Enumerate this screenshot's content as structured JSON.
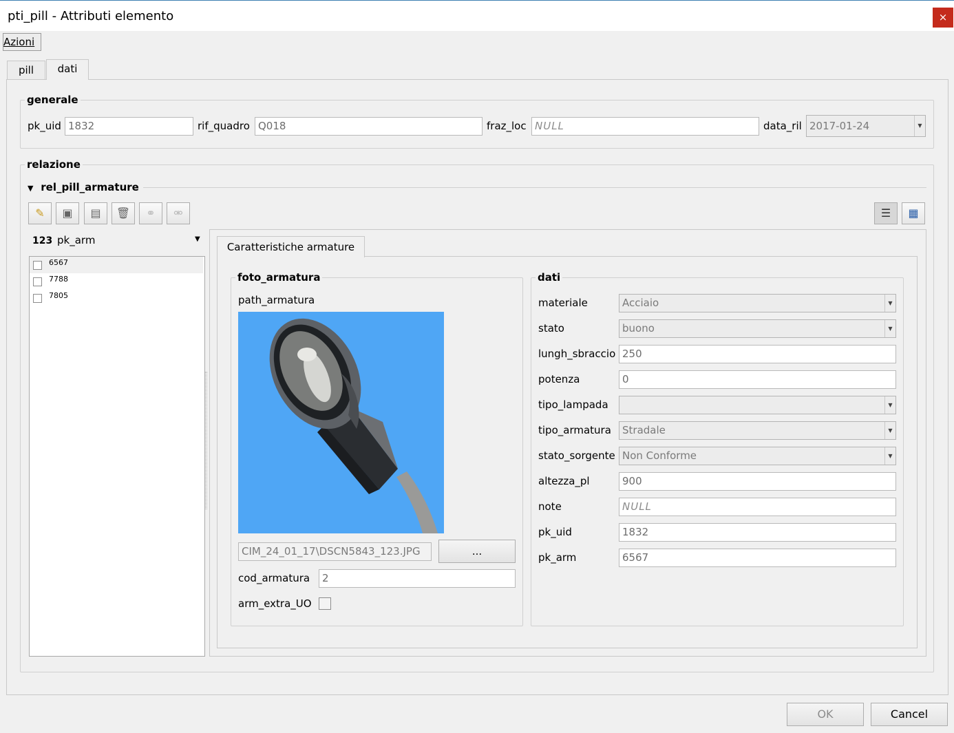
{
  "window": {
    "title": "pti_pill - Attributi elemento",
    "close": "×"
  },
  "menu": {
    "azioni": "Azioni"
  },
  "tabs": [
    {
      "label": "pill"
    },
    {
      "label": "dati"
    }
  ],
  "generale": {
    "title": "generale",
    "pk_uid_label": "pk_uid",
    "pk_uid_value": "1832",
    "rif_quadro_label": "rif_quadro",
    "rif_quadro_value": "Q018",
    "fraz_loc_label": "fraz_loc",
    "fraz_loc_value": "NULL",
    "data_ril_label": "data_ril",
    "data_ril_value": "2017-01-24"
  },
  "relazione": {
    "title": "relazione",
    "rel_title": "rel_pill_armature",
    "list_header_prefix": "123",
    "list_header": "pk_arm",
    "items": [
      "6567",
      "7788",
      "7805"
    ]
  },
  "subtab": {
    "label": "Caratteristiche armature"
  },
  "foto": {
    "title": "foto_armatura",
    "path_label": "path_armatura",
    "file_path": "CIM_24_01_17\\DSCN5843_123.JPG",
    "browse": "...",
    "cod_label": "cod_armatura",
    "cod_value": "2",
    "extra_label": "arm_extra_UO"
  },
  "dati": {
    "title": "dati",
    "fields": [
      {
        "label": "materiale",
        "value": "Acciaio"
      },
      {
        "label": "stato",
        "value": "buono"
      },
      {
        "label": "lungh_sbraccio",
        "value": "250"
      },
      {
        "label": "potenza",
        "value": "0"
      },
      {
        "label": "tipo_lampada",
        "value": ""
      },
      {
        "label": "tipo_armatura",
        "value": "Stradale"
      },
      {
        "label": "stato_sorgente",
        "value": "Non Conforme"
      },
      {
        "label": "altezza_pl",
        "value": "900"
      },
      {
        "label": "note",
        "value": "NULL"
      },
      {
        "label": "pk_uid",
        "value": "1832"
      },
      {
        "label": "pk_arm",
        "value": "6567"
      }
    ]
  },
  "buttons": {
    "ok": "OK",
    "cancel": "Cancel"
  },
  "colors": {
    "photo_sky": "#4fa6f5",
    "close_red": "#c42b1c"
  }
}
